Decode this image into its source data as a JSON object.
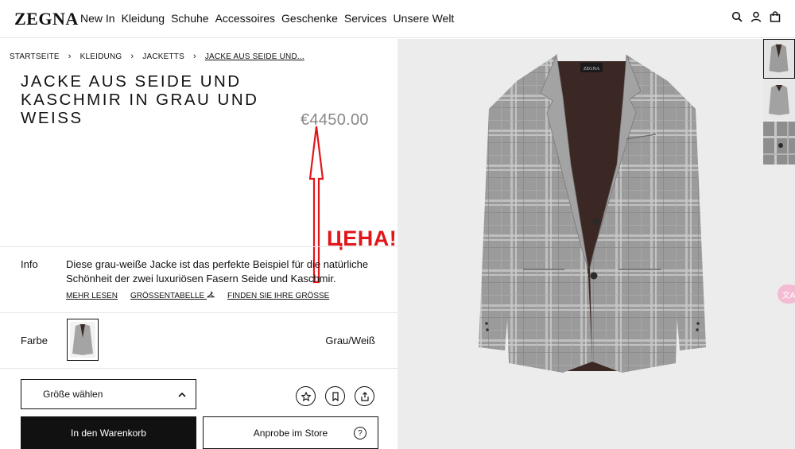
{
  "header": {
    "logo": "ZEGNA",
    "nav": [
      "New In",
      "Kleidung",
      "Schuhe",
      "Accessoires",
      "Geschenke",
      "Services",
      "Unsere Welt"
    ],
    "icons": [
      "search-icon",
      "account-icon",
      "shopping-bag-icon"
    ]
  },
  "breadcrumb": [
    "STARTSEITE",
    "KLEIDUNG",
    "JACKETTS",
    "JACKE AUS SEIDE UND..."
  ],
  "product": {
    "title": "JACKE AUS SEIDE UND KASCHMIR IN GRAU UND WEISS",
    "price": "€4450.00"
  },
  "annotation": {
    "label": "ЦЕНА!",
    "color": "#e0161a"
  },
  "info": {
    "label": "Info",
    "text": "Diese grau-weiße Jacke ist das perfekte Beispiel für die natürliche Schönheit der zwei luxuriösen Fasern Seide und Kaschmir.",
    "links": [
      "MEHR LESEN",
      "GRÖSSENTABELLE",
      "FINDEN SIE IHRE GRÖSSE"
    ]
  },
  "color": {
    "label": "Farbe",
    "value": "Grau/Weiß"
  },
  "size": {
    "placeholder": "Größe wählen"
  },
  "actions": {
    "add_to_cart": "In den Warenkorb",
    "try_in_store": "Anprobe im Store",
    "help": "?"
  },
  "gallery": {
    "thumbnail_count": 3,
    "selected": 1,
    "label_tag": "ZEGNA"
  },
  "colors": {
    "accent": "#111111",
    "price": "#888888",
    "annotation": "#e0161a"
  }
}
